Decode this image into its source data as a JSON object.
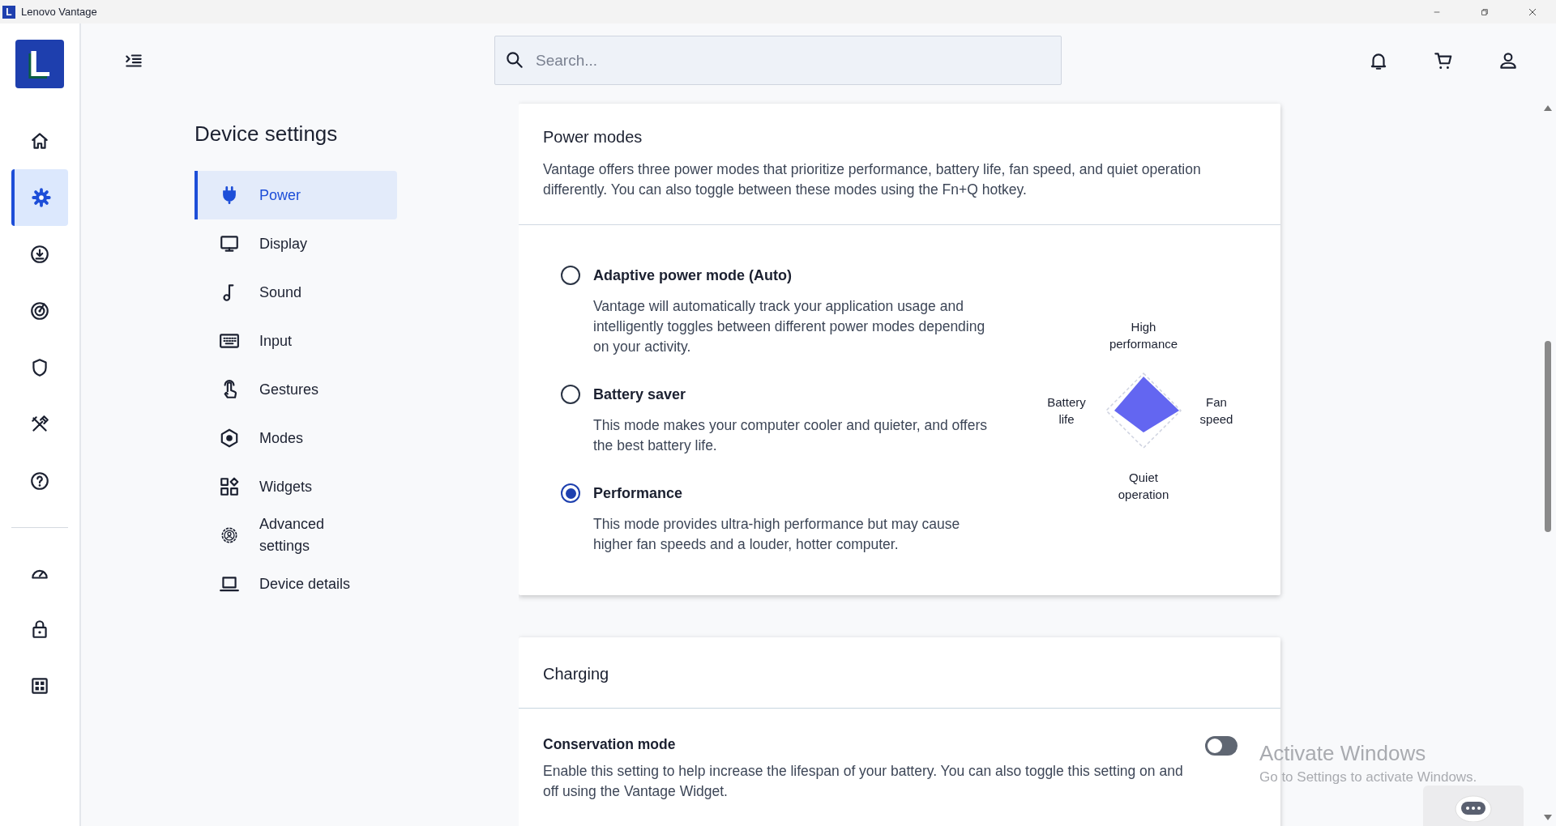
{
  "window": {
    "title": "Lenovo Vantage",
    "logo": "L"
  },
  "rail": {
    "logo": "L",
    "items": [
      {
        "selected": false
      },
      {
        "selected": true
      },
      {
        "selected": false
      },
      {
        "selected": false
      },
      {
        "selected": false
      },
      {
        "selected": false
      },
      {
        "selected": false
      }
    ],
    "bottom_items": [
      {
        "selected": false
      },
      {
        "selected": false
      },
      {
        "selected": false
      }
    ]
  },
  "header": {
    "search": {
      "placeholder": "Search..."
    }
  },
  "nav": {
    "title": "Device settings",
    "items": [
      {
        "label": "Power",
        "selected": true
      },
      {
        "label": "Display",
        "selected": false
      },
      {
        "label": "Sound",
        "selected": false
      },
      {
        "label": "Input",
        "selected": false
      },
      {
        "label": "Gestures",
        "selected": false
      },
      {
        "label": "Modes",
        "selected": false
      },
      {
        "label": "Widgets",
        "selected": false
      },
      {
        "label": "Advanced settings",
        "selected": false
      },
      {
        "label": "Device details",
        "selected": false
      }
    ]
  },
  "power_modes": {
    "title": "Power modes",
    "description": "Vantage offers three power modes that prioritize performance, battery life, fan speed, and quiet operation differently. You can also toggle between these modes using the Fn+Q hotkey.",
    "options": [
      {
        "label": "Adaptive power mode (Auto)",
        "description": "Vantage will automatically track your application usage and intelligently toggles between different power modes depending on your activity.",
        "selected": false
      },
      {
        "label": "Battery saver",
        "description": "This mode makes your computer cooler and quieter, and offers the best battery life.",
        "selected": false
      },
      {
        "label": "Performance",
        "description": "This mode provides ultra-high performance but may cause higher fan speeds and a louder, hotter computer.",
        "selected": true
      }
    ],
    "diagram": {
      "top": "High performance",
      "left": "Battery life",
      "right": "Fan speed",
      "bottom": "Quiet operation"
    }
  },
  "charging": {
    "title": "Charging",
    "setting": {
      "label": "Conservation mode",
      "description": "Enable this setting to help increase the lifespan of your battery. You can also toggle this setting on and off using the Vantage Widget.",
      "on": false
    }
  },
  "activation_notice": {
    "title": "Activate Windows",
    "subtitle": "Go to Settings to activate Windows."
  }
}
